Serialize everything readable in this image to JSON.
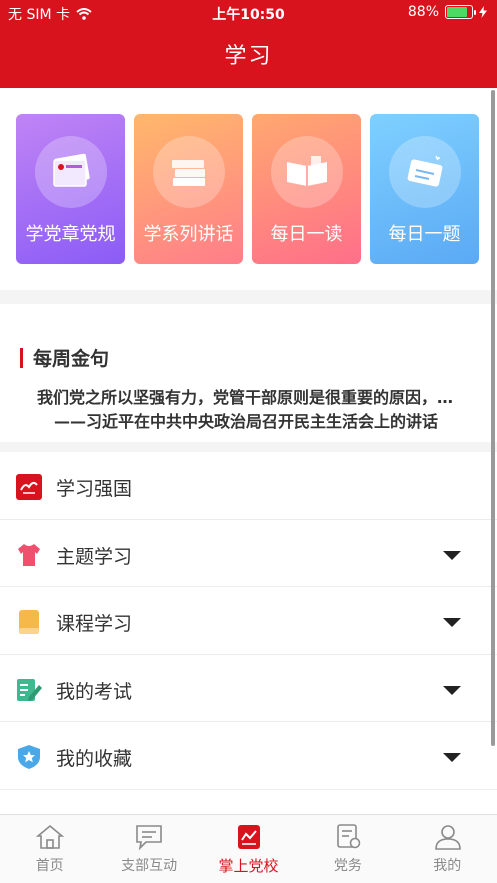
{
  "status_bar": {
    "carrier": "无 SIM 卡",
    "time": "上午10:50",
    "battery": "88%",
    "battery_level": 0.88
  },
  "header": {
    "title": "学习"
  },
  "cards": [
    {
      "label": "学党章党规",
      "icon": "party-book-icon",
      "color": "#8b5cf6"
    },
    {
      "label": "学系列讲话",
      "icon": "book-stack-icon",
      "color": "#ff7d8a"
    },
    {
      "label": "每日一读",
      "icon": "open-book-icon",
      "color": "#ff6f8a"
    },
    {
      "label": "每日一题",
      "icon": "quiz-card-icon",
      "color": "#5aa9f5"
    }
  ],
  "weekly_quote": {
    "title": "每周金句",
    "text": "我们党之所以坚强有力，党管干部原则是很重要的原因，…",
    "source": "——习近平在中共中央政治局召开民主生活会上的讲话"
  },
  "menu": [
    {
      "label": "学习强国",
      "icon": "xuexi-logo-icon",
      "expandable": false
    },
    {
      "label": "主题学习",
      "icon": "shirt-icon",
      "expandable": true
    },
    {
      "label": "课程学习",
      "icon": "course-book-icon",
      "expandable": true
    },
    {
      "label": "我的考试",
      "icon": "exam-edit-icon",
      "expandable": true
    },
    {
      "label": "我的收藏",
      "icon": "shield-star-icon",
      "expandable": true
    }
  ],
  "tabs": [
    {
      "label": "首页",
      "icon": "home-icon",
      "active": false
    },
    {
      "label": "支部互动",
      "icon": "chat-icon",
      "active": false
    },
    {
      "label": "掌上党校",
      "icon": "school-book-icon",
      "active": true
    },
    {
      "label": "党务",
      "icon": "party-affairs-icon",
      "active": false
    },
    {
      "label": "我的",
      "icon": "profile-icon",
      "active": false
    }
  ],
  "colors": {
    "brand_red": "#d9131d",
    "battery_green": "#4cd964"
  }
}
